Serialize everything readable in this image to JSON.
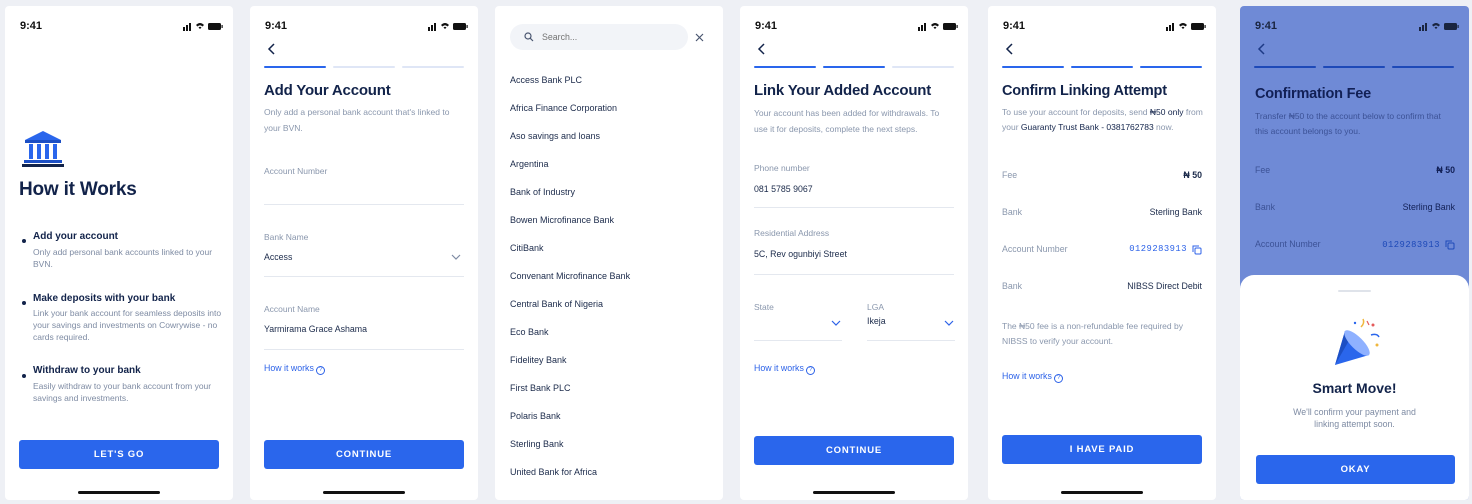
{
  "status": {
    "time": "9:41"
  },
  "screen1": {
    "title": "How it Works",
    "items": [
      {
        "title": "Add your account",
        "desc": "Only add personal bank accounts linked to your BVN."
      },
      {
        "title": "Make deposits with your bank",
        "desc": "Link your bank account for seamless deposits into your savings and investments on Cowrywise - no cards required."
      },
      {
        "title": "Withdraw to your bank",
        "desc": "Easily withdraw to your bank account from your savings and investments."
      }
    ],
    "button": "LET'S GO"
  },
  "screen2": {
    "title": "Add Your Account",
    "subtitle": "Only add a personal bank account that's linked to your BVN.",
    "account_number_label": "Account Number",
    "bank_name_label": "Bank Name",
    "bank_name_value": "Access",
    "account_name_label": "Account Name",
    "account_name_value": "Yarmirama Grace Ashama",
    "how_link": "How it works",
    "button": "CONTINUE"
  },
  "screen3": {
    "search_placeholder": "Search...",
    "banks": [
      "Access Bank PLC",
      "Africa Finance Corporation",
      "Aso savings and loans",
      "Argentina",
      "Bank of Industry",
      "Bowen Microfinance Bank",
      "CitiBank",
      "Convenant Microfinance Bank",
      "Central Bank of Nigeria",
      "Eco Bank",
      "Fidelitey Bank",
      "First Bank PLC",
      "Polaris Bank",
      "Sterling Bank",
      "United Bank for Africa"
    ]
  },
  "screen4": {
    "title": "Link Your Added Account",
    "subtitle": "Your account has been added for withdrawals. To use it for deposits, complete the next steps.",
    "phone_label": "Phone number",
    "phone_value": "081 5785 9067",
    "address_label": "Residential Address",
    "address_value": "5C, Rev ogunbiyi Street",
    "state_label": "State",
    "lga_label": "LGA",
    "lga_value": "Ikeja",
    "how_link": "How it works",
    "button": "CONTINUE"
  },
  "screen5": {
    "title": "Confirm Linking Attempt",
    "subtitle_pre": "To use your account for deposits, send ",
    "subtitle_amount": "₦50 only",
    "subtitle_mid": " from your ",
    "subtitle_bank": "Guaranty Trust Bank - 0381762783",
    "subtitle_post": " now.",
    "rows": [
      {
        "label": "Fee",
        "value": "₦ 50"
      },
      {
        "label": "Bank",
        "value": "Sterling Bank"
      },
      {
        "label": "Account Number",
        "value": "0129283913"
      },
      {
        "label": "Bank",
        "value": "NIBSS Direct Debit"
      }
    ],
    "note": "The ₦50 fee is a non-refundable fee required by NIBSS to verify your account.",
    "how_link": "How it works",
    "button": "I HAVE PAID"
  },
  "screen6": {
    "title": "Confirmation Fee",
    "subtitle": "Transfer ₦50 to the account below to confirm that this account belongs to you.",
    "rows": [
      {
        "label": "Fee",
        "value": "₦ 50"
      },
      {
        "label": "Bank",
        "value": "Sterling Bank"
      },
      {
        "label": "Account Number",
        "value": "0129283913"
      }
    ],
    "sheet_title": "Smart Move!",
    "sheet_desc": "We'll confirm your payment and linking attempt soon.",
    "button": "OKAY"
  },
  "colors": {
    "accent": "#2a66ec",
    "text": "#12234a",
    "muted": "#8a97ad",
    "overlay": "#6f8ad6"
  }
}
